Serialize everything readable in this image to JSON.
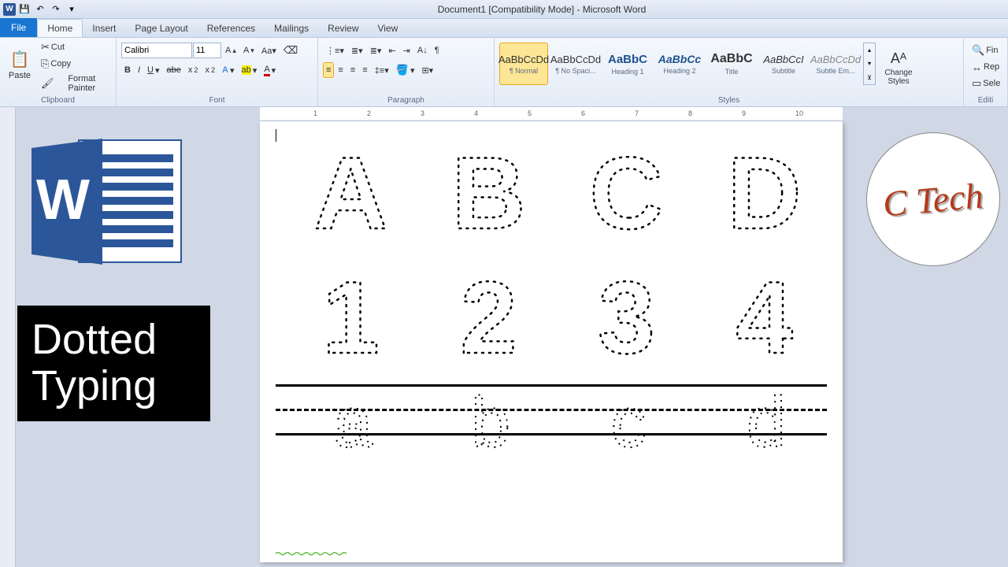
{
  "app": {
    "title": "Document1 [Compatibility Mode] - Microsoft Word"
  },
  "qat": {
    "save": "💾",
    "undo": "↶",
    "redo": "↷"
  },
  "tabs": [
    "File",
    "Home",
    "Insert",
    "Page Layout",
    "References",
    "Mailings",
    "Review",
    "View"
  ],
  "clipboard": {
    "paste": "Paste",
    "cut": "Cut",
    "copy": "Copy",
    "fp": "Format Painter",
    "label": "Clipboard"
  },
  "font": {
    "name": "Calibri",
    "size": "11",
    "label": "Font"
  },
  "paragraph": {
    "label": "Paragraph"
  },
  "styles": {
    "label": "Styles",
    "items": [
      {
        "prev": "AaBbCcDd",
        "name": "¶ Normal",
        "sel": true
      },
      {
        "prev": "AaBbCcDd",
        "name": "¶ No Spaci..."
      },
      {
        "prev": "AaBbC",
        "name": "Heading 1",
        "style": "color:#1f5290;font-weight:bold;font-size:15px"
      },
      {
        "prev": "AaBbCc",
        "name": "Heading 2",
        "style": "color:#1f5290;font-weight:bold;font-style:italic;font-size:14px"
      },
      {
        "prev": "AaBbC",
        "name": "Title",
        "style": "font-weight:bold;font-size:16px"
      },
      {
        "prev": "AaBbCcI",
        "name": "Subtitle",
        "style": "font-style:italic"
      },
      {
        "prev": "AaBbCcDd",
        "name": "Subtle Em...",
        "style": "font-style:italic;color:#888"
      }
    ],
    "change": "Change Styles"
  },
  "editing": {
    "label": "Editi",
    "find": "Fin",
    "replace": "Rep",
    "select": "Sele"
  },
  "overlay": {
    "line1": "Dotted",
    "line2": "Typing",
    "badge": "C Tech"
  },
  "doc": {
    "row1": [
      "A",
      "B",
      "C",
      "D"
    ],
    "row2": [
      "1",
      "2",
      "3",
      "4"
    ],
    "row3": [
      "a",
      "b",
      "c",
      "d"
    ]
  }
}
